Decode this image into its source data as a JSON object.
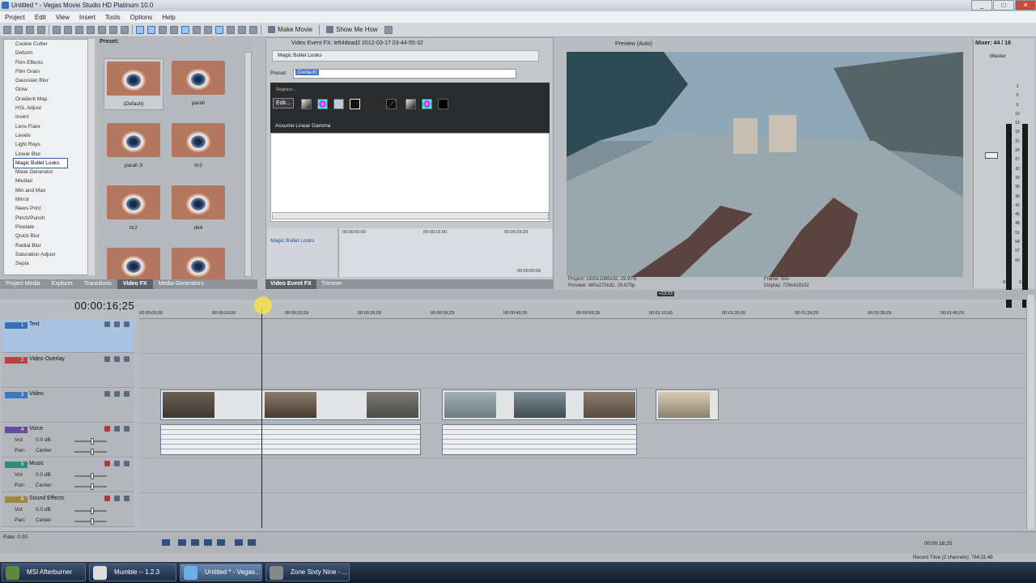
{
  "window": {
    "title": "Untitled * - Vegas Movie Studio HD Platinum 10.0",
    "controls": [
      "_",
      "□",
      "✕"
    ]
  },
  "menu": [
    "Project",
    "Edit",
    "View",
    "Insert",
    "Tools",
    "Options",
    "Help"
  ],
  "toolbar": {
    "make_movie": "Make Movie",
    "show_me_how": "Show Me How"
  },
  "fx_list": [
    "Cookie Cutter",
    "Deform",
    "Film Effects",
    "Film Grain",
    "Gaussian Blur",
    "Glow",
    "Gradient Map",
    "HSL Adjust",
    "Invert",
    "Lens Flare",
    "Levels",
    "Light Rays",
    "Linear Blur",
    "Magic Bullet Looks",
    "Mask Generator",
    "Median",
    "Min and Max",
    "Mirror",
    "News Print",
    "Pinch/Punch",
    "Pixelate",
    "Quick Blur",
    "Radial Blur",
    "Saturation Adjust",
    "Sepia"
  ],
  "fx_selected": "Magic Bullet Looks",
  "presets": {
    "header": "Preset:",
    "items": [
      "(Default)",
      "parah",
      "parah 3",
      "hr3",
      "hr2",
      "dk4",
      "",
      ""
    ]
  },
  "left_tabs": [
    "Project Media",
    "Explorer",
    "Transitions",
    "Video FX",
    "Media Generators"
  ],
  "left_tab_active": "Video FX",
  "fx_panel": {
    "header": "Video Event FX: left4dead2 2012-03-17 03-44-55-32",
    "chain": "Magic Bullet Looks",
    "preset_label": "Preset:",
    "preset_value": "(Default)",
    "register": "Register...",
    "edit": "Edit...",
    "gamma": "Assume Linear Gamma",
    "keyframe_item": "Magic Bullet Looks",
    "kf_times": [
      "00:00:00:00",
      "00:00:15:00",
      "00:00:29:29"
    ],
    "kf_end": "00:00:00;00",
    "tabs": [
      "Video Event FX",
      "Trimmer"
    ],
    "tab_active": "Video Event FX"
  },
  "preview": {
    "mode": "Preview (Auto)",
    "project_label": "Project:",
    "project_value": "1920x1080x32, 29.970i",
    "preview_label": "Preview:",
    "preview_value": "480x270x32, 29.970p",
    "frame_label": "Frame:",
    "frame_value": "505",
    "display_label": "Display:",
    "display_value": "729x410x32"
  },
  "mixer": {
    "title": "Mixer: 44 / 16",
    "master": "Master",
    "scale": [
      "3",
      "6",
      "9",
      "12",
      "15",
      "18",
      "21",
      "24",
      "27",
      "30",
      "33",
      "36",
      "39",
      "42",
      "45",
      "48",
      "51",
      "54",
      "57",
      "60"
    ],
    "readout_l": "0.0",
    "readout_r": "0.0"
  },
  "timeline": {
    "timecode": "00:00:16;25",
    "ruler": [
      "00:00:00;00",
      "00:00:10;00",
      "00:00:19;29",
      "00:00:29;29",
      "00:00:39;29",
      "00:00:49;29",
      "00:00:59;28",
      "00:01:10;00",
      "00:01:20;00",
      "00:01:29;29",
      "00:01:39;29",
      "00:01:49;29"
    ],
    "zoom_marker": "+13:23",
    "tracks": [
      {
        "num": "1",
        "name": "Text"
      },
      {
        "num": "2",
        "name": "Video Overlay"
      },
      {
        "num": "3",
        "name": "Video"
      },
      {
        "num": "4",
        "name": "Voice",
        "vol": "0.0 dB",
        "pan": "Center"
      },
      {
        "num": "5",
        "name": "Music",
        "vol": "0.0 dB",
        "pan": "Center"
      },
      {
        "num": "6",
        "name": "Sound Effects",
        "vol": "0.0 dB",
        "pan": "Center"
      }
    ],
    "vol_label": "Vol:",
    "pan_label": "Pan:"
  },
  "transport": {
    "rate": "Rate: 0.00",
    "end_time": "00:00:16;25",
    "record_time": "Record Time (2 channels): 784:31:45"
  },
  "taskbar": [
    "MSI Afterburner",
    "Mumble -- 1.2.3",
    "Untitled * - Vegas...",
    "Zone Sixty Nine - ..."
  ],
  "taskbar_active": "Untitled * - Vegas..."
}
